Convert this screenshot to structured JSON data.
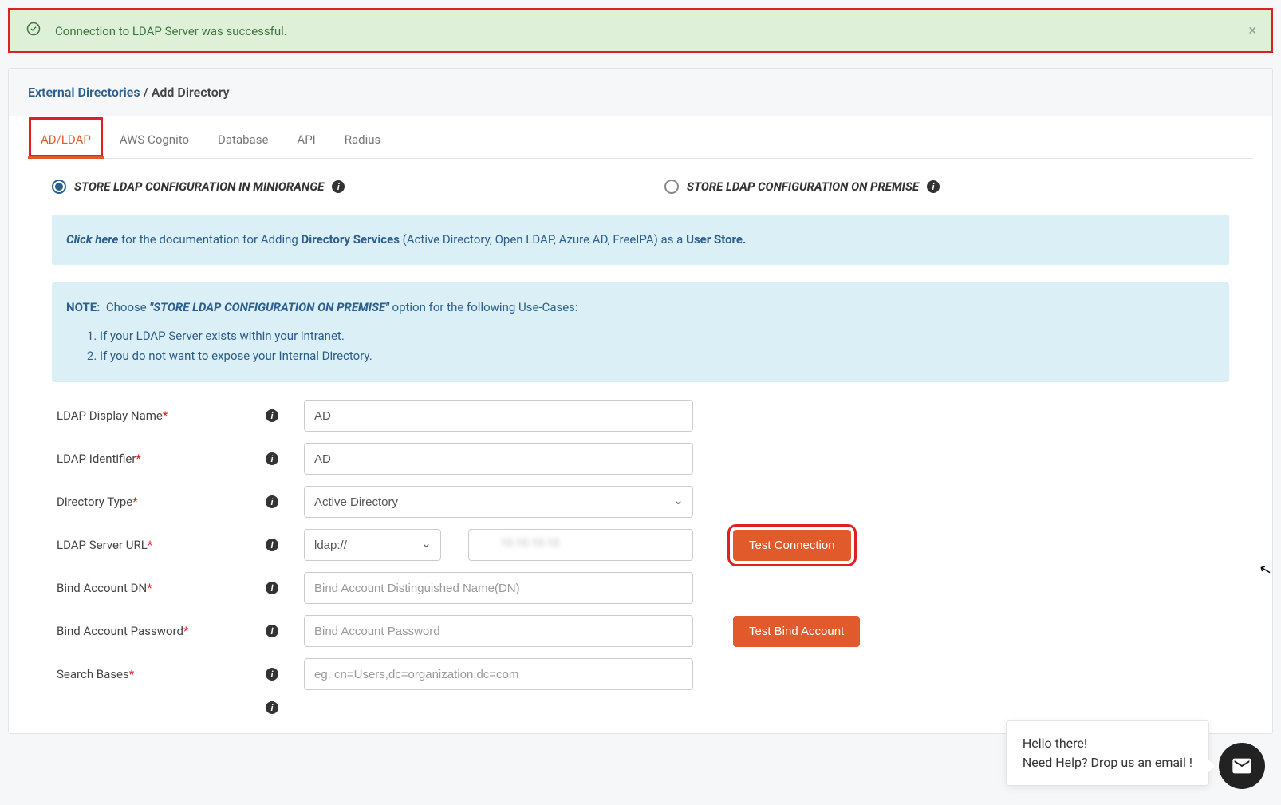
{
  "alert": {
    "message": "Connection to LDAP Server was successful."
  },
  "breadcrumb": {
    "parent": "External Directories",
    "separator": "/",
    "current": "Add Directory"
  },
  "tabs": [
    "AD/LDAP",
    "AWS Cognito",
    "Database",
    "API",
    "Radius"
  ],
  "radios": {
    "miniorange": "STORE LDAP CONFIGURATION IN MINIORANGE",
    "onprem": "STORE LDAP CONFIGURATION ON PREMISE"
  },
  "doc_info": {
    "click_here": "Click here",
    "text_mid": " for the documentation for Adding ",
    "dir_services": "Directory Services",
    "after": " (Active Directory, Open LDAP, Azure AD, FreeIPA) as a ",
    "user_store": "User Store."
  },
  "note": {
    "label": "NOTE:",
    "lead": "Choose",
    "quoted": "\"STORE LDAP CONFIGURATION ON PREMISE\"",
    "tail": " option for the following Use-Cases:",
    "cases": [
      "If your LDAP Server exists within your intranet.",
      "If you do not want to expose your Internal Directory."
    ]
  },
  "form": {
    "display_name_label": "LDAP Display Name",
    "display_name_value": "AD",
    "identifier_label": "LDAP Identifier",
    "identifier_value": "AD",
    "dir_type_label": "Directory Type",
    "dir_type_value": "Active Directory",
    "server_url_label": "LDAP Server URL",
    "protocol_value": "ldap://",
    "host_value": "",
    "test_conn_btn": "Test Connection",
    "bind_dn_label": "Bind Account DN",
    "bind_dn_placeholder": "Bind Account Distinguished Name(DN)",
    "bind_pw_label": "Bind Account Password",
    "bind_pw_placeholder": "Bind Account Password",
    "test_bind_btn": "Test Bind Account",
    "search_bases_label": "Search Bases",
    "search_bases_placeholder": "eg. cn=Users,dc=organization,dc=com"
  },
  "chat": {
    "line1": "Hello there!",
    "line2": "Need Help? Drop us an email !"
  }
}
